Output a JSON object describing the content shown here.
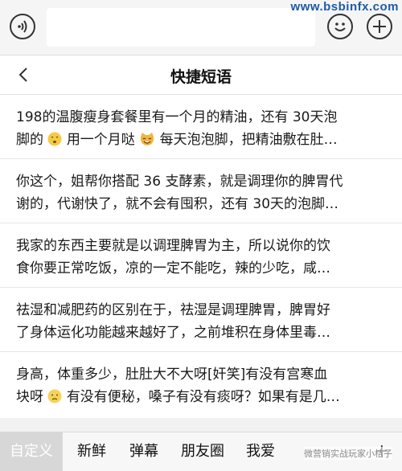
{
  "watermark": "www.bsbinfx.com",
  "nav": {
    "title": "快捷短语"
  },
  "phrases": [
    {
      "line1": "198的温腹瘦身套餐里有一个月的精油，还有 30天泡",
      "line2_a": "脚的",
      "line2_b": "用一个月哒",
      "line2_c": "每天泡泡脚，把精油敷在肚…"
    },
    {
      "line1": "你这个，姐帮你搭配 36 支酵素，就是调理你的脾胃代",
      "line2": "谢的，代谢快了，就不会有囤积，还有 30天的泡脚…"
    },
    {
      "line1": "我家的东西主要就是以调理脾胃为主，所以说你的饮",
      "line2": "食你要正常吃饭，凉的一定不能吃，辣的少吃，咸…"
    },
    {
      "line1": "祛湿和减肥药的区别在于，祛湿是调理脾胃，脾胃好",
      "line2": "了身体运化功能越来越好了，之前堆积在身体里毒…"
    },
    {
      "line1": "身高，体重多少，肚肚大不大呀[奸笑]有没有宫寒血",
      "line2_a": "块呀",
      "line2_b": "有没有便秘，嗓子有没有痰呀？如果有是几…"
    }
  ],
  "tabs": [
    "自定义",
    "新鲜",
    "弹幕",
    "朋友圈",
    "我爱"
  ],
  "more": "+",
  "credit": "微营销实战玩家小桔子",
  "icons": [
    "voice-icon",
    "emoji-face-icon",
    "add-icon",
    "back-chevron-icon",
    "smirk-face-icon",
    "cat-face-icon",
    "frown-face-icon"
  ]
}
